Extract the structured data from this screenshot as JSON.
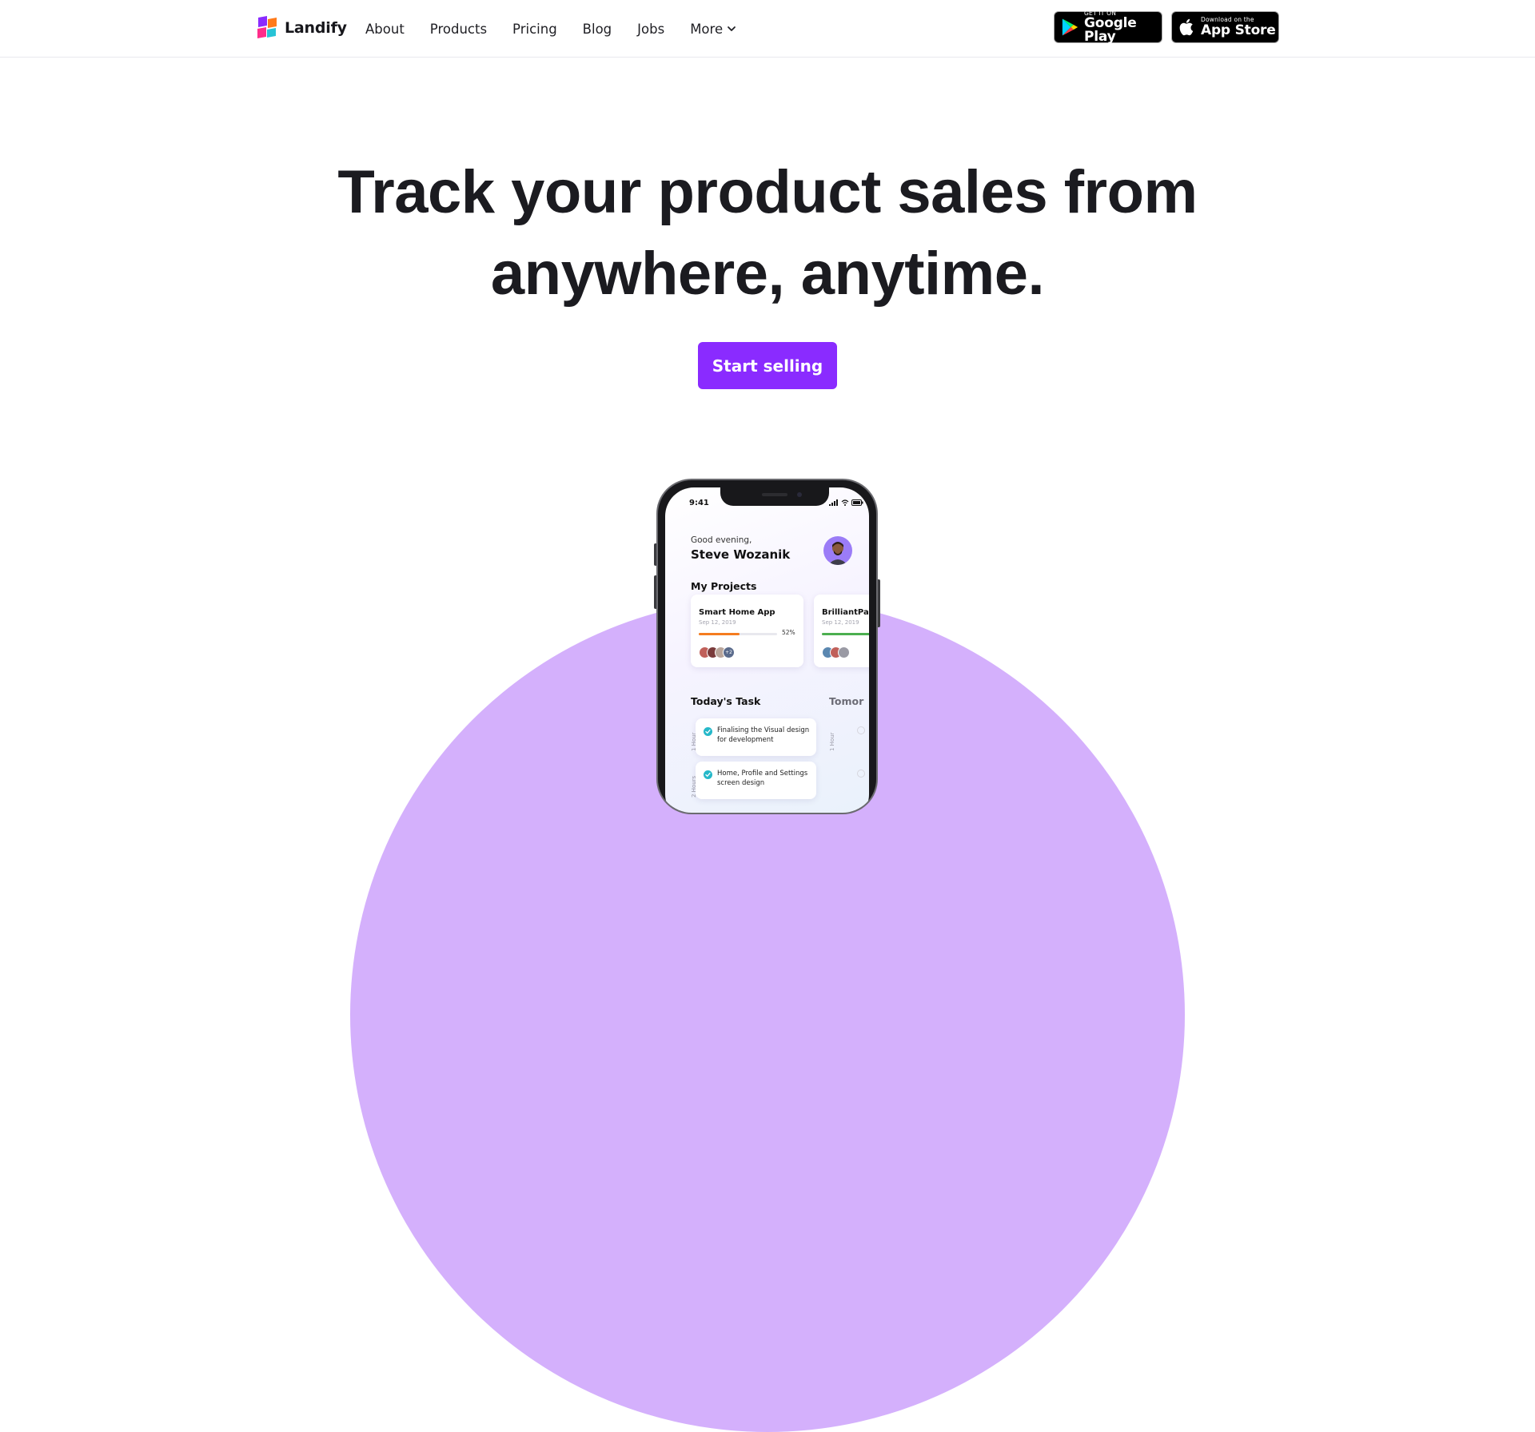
{
  "brand": {
    "name": "Landify"
  },
  "nav": {
    "items": [
      "About",
      "Products",
      "Pricing",
      "Blog",
      "Jobs",
      "More"
    ]
  },
  "stores": {
    "google": {
      "small": "GET IT ON",
      "big": "Google Play"
    },
    "apple": {
      "small": "Download on the",
      "big": "App Store"
    }
  },
  "hero": {
    "line1": "Track your product sales from",
    "line2": "anywhere, anytime.",
    "cta": "Start selling"
  },
  "colors": {
    "accent": "#8a2bff",
    "blob": "#d4b0fc",
    "text": "#1b1b20"
  },
  "phone": {
    "time": "9:41",
    "greeting": "Good evening,",
    "user": "Steve Wozanik",
    "projects_title": "My Projects",
    "projects": [
      {
        "name": "Smart Home App",
        "date": "Sep 12, 2019",
        "progress": 0.52,
        "percent": "52%",
        "bar_color": "#f57c1f",
        "extra": "+2"
      },
      {
        "name": "BrilliantPad A",
        "date": "Sep 12, 2019",
        "progress": 0.9,
        "bar_color": "#4caf50"
      }
    ],
    "today_title": "Today's Task",
    "tomorrow_title": "Tomor",
    "hours": [
      "1 Hour",
      "2 Hours"
    ],
    "tasks": [
      {
        "text": "Finalising the Visual design for development"
      },
      {
        "text": "Home, Profile and Settings screen design"
      }
    ]
  }
}
